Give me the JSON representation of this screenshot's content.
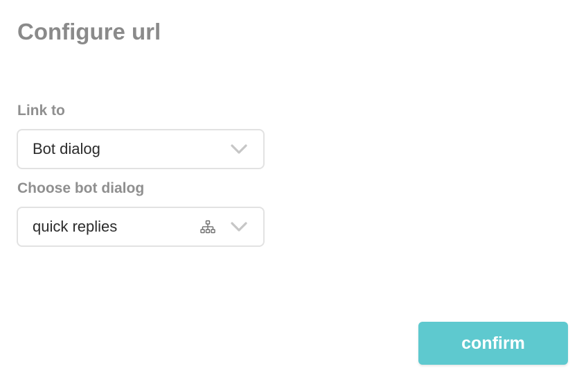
{
  "dialog": {
    "title": "Configure url"
  },
  "link_to": {
    "label": "Link to",
    "selected": "Bot dialog",
    "icon": "chevron-down-icon"
  },
  "bot_dialog": {
    "label": "Choose bot dialog",
    "selected": "quick replies",
    "icons": [
      "sitemap-icon",
      "chevron-down-icon"
    ]
  },
  "actions": {
    "confirm_label": "confirm"
  },
  "colors": {
    "title": "#8a8a8a",
    "label": "#8f8f8f",
    "border": "#e2e2e2",
    "chevron": "#c6c6c6",
    "accent": "#5ec9cf"
  }
}
